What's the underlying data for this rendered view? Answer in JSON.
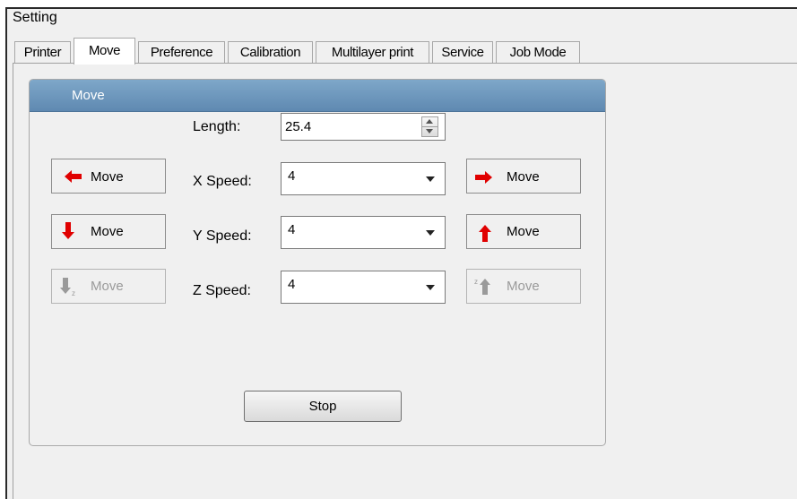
{
  "window": {
    "title": "Setting"
  },
  "tabs": [
    {
      "label": "Printer",
      "active": false
    },
    {
      "label": "Move",
      "active": true
    },
    {
      "label": "Preference",
      "active": false
    },
    {
      "label": "Calibration",
      "active": false
    },
    {
      "label": "Multilayer print",
      "active": false
    },
    {
      "label": "Service",
      "active": false
    },
    {
      "label": "Job Mode",
      "active": false
    }
  ],
  "move_group": {
    "title": "Move",
    "length": {
      "label": "Length:",
      "value": "25.4"
    },
    "x_speed": {
      "label": "X Speed:",
      "value": "4"
    },
    "y_speed": {
      "label": "Y Speed:",
      "value": "4"
    },
    "z_speed": {
      "label": "Z Speed:",
      "value": "4"
    },
    "buttons": {
      "x_left": {
        "label": "Move",
        "icon": "arrow-left-icon",
        "enabled": true
      },
      "x_right": {
        "label": "Move",
        "icon": "arrow-right-icon",
        "enabled": true
      },
      "y_down": {
        "label": "Move",
        "icon": "arrow-down-icon",
        "enabled": true
      },
      "y_up": {
        "label": "Move",
        "icon": "arrow-up-icon",
        "enabled": true
      },
      "z_down": {
        "label": "Move",
        "icon": "z-down-icon",
        "enabled": false
      },
      "z_up": {
        "label": "Move",
        "icon": "z-up-icon",
        "enabled": false
      }
    },
    "stop_label": "Stop"
  },
  "colors": {
    "arrow_red": "#e00000",
    "disabled_gray": "#9a9a9a",
    "header_blue": "#6b93b9"
  }
}
